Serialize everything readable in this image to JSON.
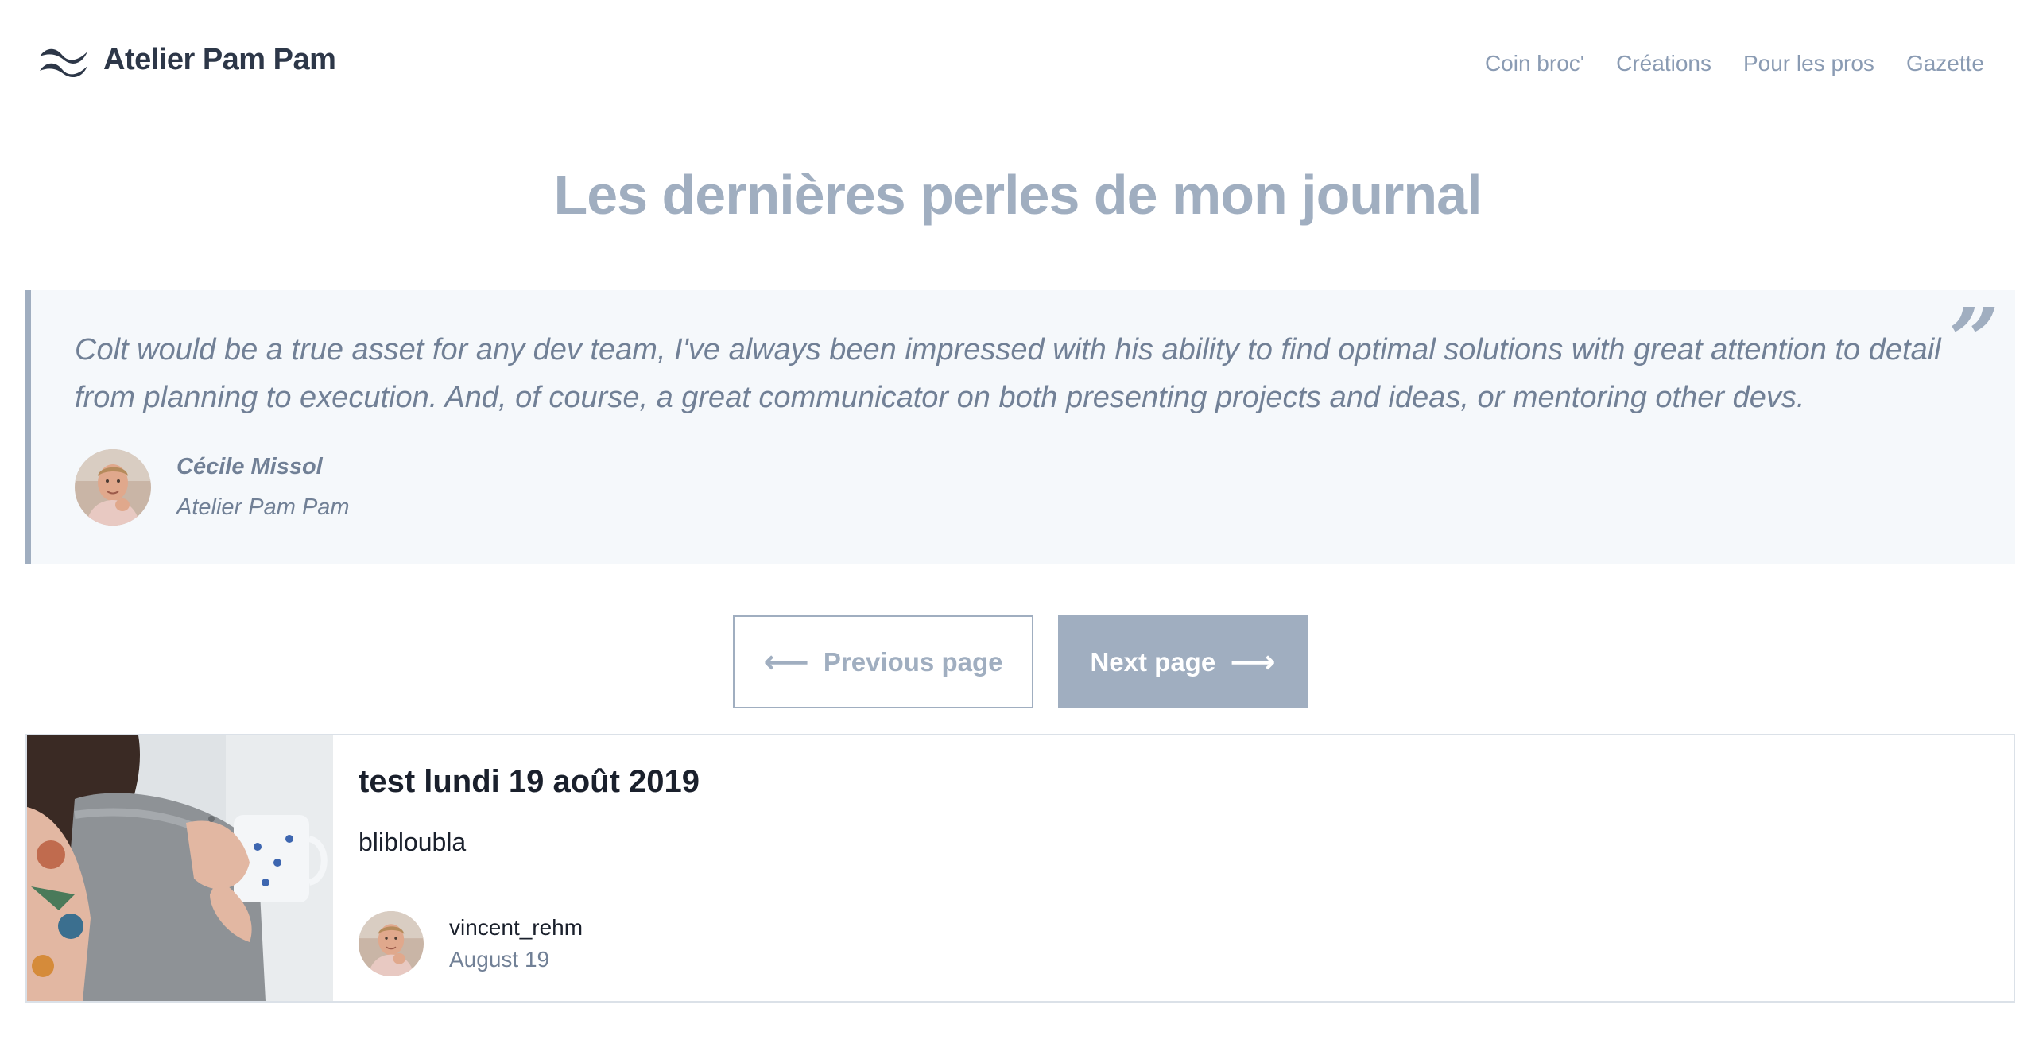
{
  "header": {
    "brand_name": "Atelier Pam Pam",
    "nav": [
      "Coin broc'",
      "Créations",
      "Pour les pros",
      "Gazette"
    ]
  },
  "page_title": "Les dernières perles de mon journal",
  "testimonial": {
    "quote": "Colt would be a true asset for any dev team, I've always been impressed with his ability to find optimal solutions with great attention to detail from planning to execution. And, of course, a great communicator on both presenting projects and ideas, or mentoring other devs.",
    "quote_mark": "”",
    "author_name": "Cécile Missol",
    "author_company": "Atelier Pam Pam"
  },
  "pagination": {
    "previous_label": "Previous page",
    "next_label": "Next page",
    "previous_arrow": "⟵",
    "next_arrow": "⟶"
  },
  "post": {
    "title": "test lundi 19 août 2019",
    "excerpt": "blibloubla",
    "author": "vincent_rehm",
    "date": "August 19"
  },
  "colors": {
    "muted": "#a0aec0",
    "nav_text": "#8a9bb3",
    "testimonial_bg": "#f5f8fb",
    "brand_text": "#2d3748"
  }
}
